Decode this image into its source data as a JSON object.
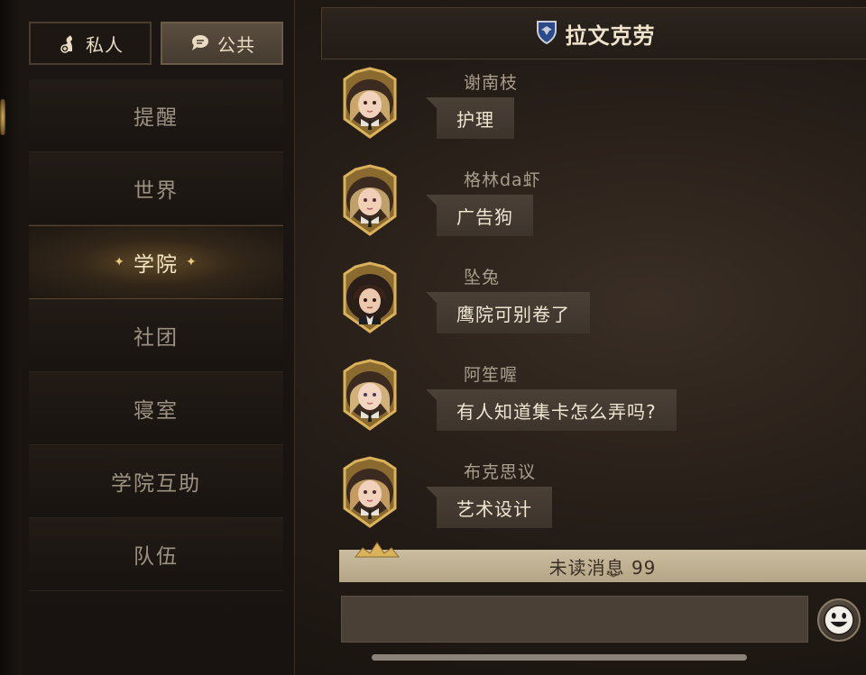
{
  "tabs": {
    "private_label": "私人",
    "public_label": "公共"
  },
  "sidebar": {
    "items": [
      {
        "label": "提醒",
        "active": false
      },
      {
        "label": "世界",
        "active": false
      },
      {
        "label": "学院",
        "active": true
      },
      {
        "label": "社团",
        "active": false
      },
      {
        "label": "寝室",
        "active": false
      },
      {
        "label": "学院互助",
        "active": false
      },
      {
        "label": "队伍",
        "active": false
      }
    ]
  },
  "header": {
    "title": "拉文克劳",
    "crest_icon": "ravenclaw-crest-icon"
  },
  "messages": [
    {
      "sender": "谢南枝",
      "text": "护理",
      "avatar": "female-blonde-avatar"
    },
    {
      "sender": "格林da虾",
      "text": "广告狗",
      "avatar": "female-blonde-avatar"
    },
    {
      "sender": "坠兔",
      "text": "鹰院可别卷了",
      "avatar": "male-dark-hair-avatar"
    },
    {
      "sender": "阿笙喔",
      "text": "有人知道集卡怎么弄吗?",
      "avatar": "female-blonde-avatar"
    },
    {
      "sender": "布克思议",
      "text": "艺术设计",
      "avatar": "female-blonde-avatar"
    }
  ],
  "unread": {
    "label": "未读消息 99"
  },
  "input": {
    "value": "",
    "placeholder": ""
  },
  "emoji_icon": "smiley-icon",
  "colors": {
    "accent_gold": "#d9b25a",
    "bubble": "#463c32",
    "unread_bar": "#c0b293"
  }
}
